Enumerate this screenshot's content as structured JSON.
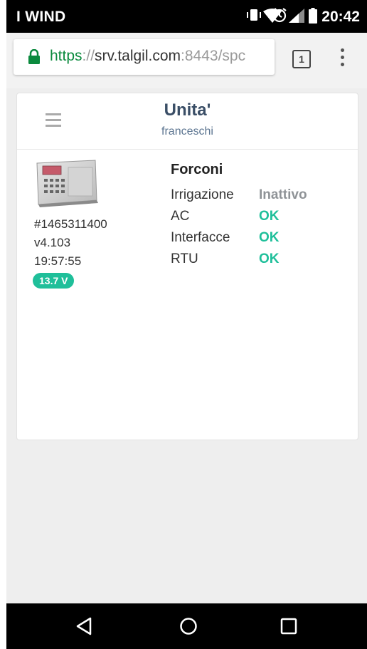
{
  "status_bar": {
    "carrier": "I WIND",
    "time": "20:42",
    "icons": [
      "vibrate-icon",
      "alarm-icon",
      "wifi-icon",
      "signal-icon",
      "battery-icon"
    ]
  },
  "browser": {
    "url_protocol": "https",
    "url_separator": "://",
    "url_host": "srv.talgil.com",
    "url_rest": ":8443/spc",
    "tab_count": "1"
  },
  "header": {
    "title": "Unita'",
    "subtitle": "franceschi"
  },
  "unit": {
    "serial": "#1465311400",
    "version": "v4.103",
    "time": "19:57:55",
    "voltage": "13.7 V",
    "name": "Forconi",
    "status": [
      {
        "label": "Irrigazione",
        "value": "Inattivo"
      },
      {
        "label": "AC",
        "value": "OK"
      },
      {
        "label": "Interfacce",
        "value": "OK"
      },
      {
        "label": "RTU",
        "value": "OK"
      }
    ]
  },
  "colors": {
    "accent": "#1fbf9a",
    "title": "#3a4e66",
    "inactive": "#8f9397",
    "secure": "#0b8a3e"
  }
}
